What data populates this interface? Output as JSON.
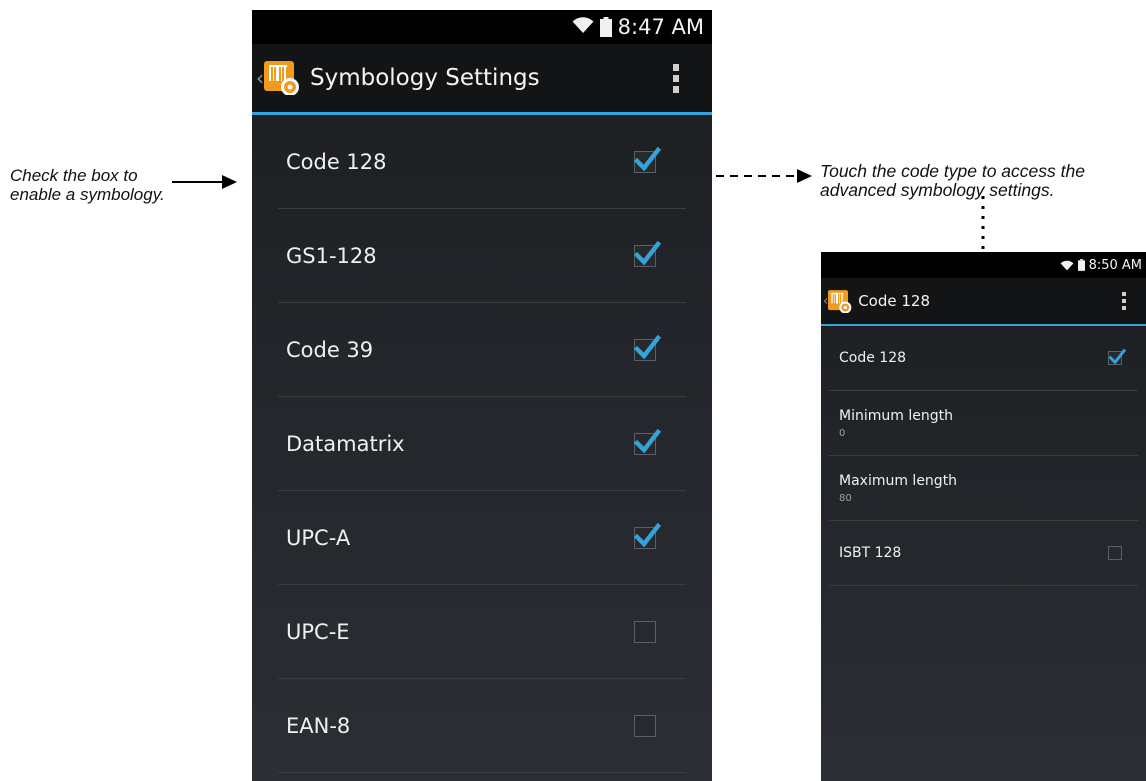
{
  "annotations": {
    "left_line1": "Check the box to",
    "left_line2": "enable a symbology.",
    "right_line1": "Touch the code type to access the",
    "right_line2": "advanced symbology settings."
  },
  "main_screen": {
    "status_time": "8:47 AM",
    "title": "Symbology Settings",
    "items": [
      {
        "label": "Code 128",
        "checked": true
      },
      {
        "label": "GS1-128",
        "checked": true
      },
      {
        "label": "Code 39",
        "checked": true
      },
      {
        "label": "Datamatrix",
        "checked": true
      },
      {
        "label": "UPC-A",
        "checked": true
      },
      {
        "label": "UPC-E",
        "checked": false
      },
      {
        "label": "EAN-8",
        "checked": false
      }
    ]
  },
  "detail_screen": {
    "status_time": "8:50 AM",
    "title": "Code 128",
    "items": [
      {
        "label": "Code 128",
        "checked": true
      },
      {
        "label": "Minimum length",
        "summary": "0"
      },
      {
        "label": "Maximum length",
        "summary": "80"
      },
      {
        "label": "ISBT 128",
        "checked": false
      }
    ]
  },
  "colors": {
    "accent": "#33a3d9",
    "app_icon": "#f29a1e",
    "background": "#222529"
  },
  "icons": [
    "wifi-icon",
    "battery-icon",
    "scanner-settings-app-icon",
    "overflow-menu-icon",
    "check-icon",
    "up-chevron-icon"
  ]
}
